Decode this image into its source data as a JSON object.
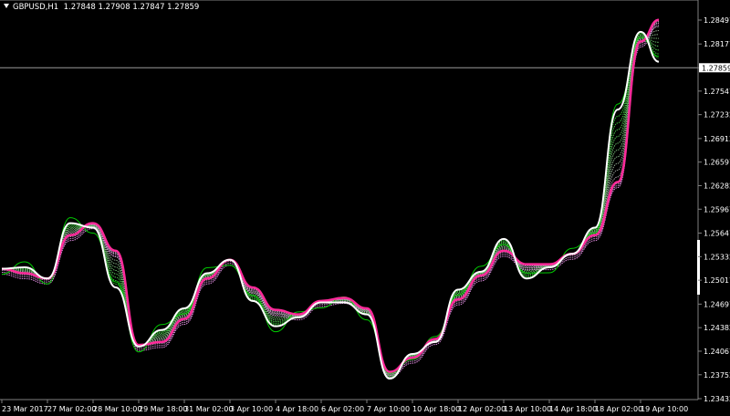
{
  "header": {
    "symbol_timeframe": "GBPUSD,H1",
    "ohlc": "1.27848 1.27908 1.27847 1.27859"
  },
  "colors": {
    "background": "#000000",
    "fast_ma": "#ffffff",
    "slow_ma": "#ff2a9a",
    "ribbon_start": "#22cc22",
    "ribbon_end": "#dd88dd",
    "price": "#00cc00",
    "grid": "#808080"
  },
  "chart_data": {
    "type": "line",
    "title": "",
    "current_price": 1.27859,
    "ylim": [
      1.23432,
      1.28497
    ],
    "y_ticks": [
      "1.28497",
      "1.28177",
      "1.27859",
      "1.27547",
      "1.27232",
      "1.26912",
      "1.26597",
      "1.26282",
      "1.25967",
      "1.25647",
      "1.25332",
      "1.25017",
      "1.24697",
      "1.24382",
      "1.24067",
      "1.23752",
      "1.23432"
    ],
    "x_tick_labels": [
      "23 Mar 2017",
      "27 Mar 02:00",
      "28 Mar 10:00",
      "29 Mar 18:00",
      "31 Mar 02:00",
      "3 Apr 10:00",
      "4 Apr 18:00",
      "6 Apr 02:00",
      "7 Apr 10:00",
      "10 Apr 18:00",
      "12 Apr 02:00",
      "13 Apr 10:00",
      "14 Apr 18:00",
      "18 Apr 02:00",
      "19 Apr 10:00"
    ],
    "x": [
      "23 Mar 18:00",
      "24 Mar 10:00",
      "27 Mar 02:00",
      "27 Mar 18:00",
      "28 Mar 10:00",
      "29 Mar 02:00",
      "29 Mar 18:00",
      "30 Mar 10:00",
      "31 Mar 02:00",
      "31 Mar 18:00",
      "3 Apr 10:00",
      "4 Apr 02:00",
      "4 Apr 18:00",
      "5 Apr 10:00",
      "6 Apr 02:00",
      "6 Apr 18:00",
      "7 Apr 10:00",
      "10 Apr 02:00",
      "10 Apr 18:00",
      "11 Apr 10:00",
      "12 Apr 02:00",
      "12 Apr 18:00",
      "13 Apr 10:00",
      "14 Apr 02:00",
      "14 Apr 18:00",
      "17 Apr 10:00",
      "18 Apr 02:00",
      "18 Apr 18:00",
      "19 Apr 10:00",
      "19 Apr 22:00"
    ],
    "series": [
      {
        "values": [
          1.2517,
          1.2519,
          1.2504,
          1.2578,
          1.2572,
          1.2492,
          1.2413,
          1.2435,
          1.2464,
          1.2511,
          1.2529,
          1.2474,
          1.244,
          1.2452,
          1.2472,
          1.2472,
          1.2456,
          1.237,
          1.2403,
          1.2419,
          1.2489,
          1.2513,
          1.2557,
          1.2504,
          1.2519,
          1.2537,
          1.2572,
          1.273,
          1.2834,
          1.2794
        ]
      },
      {
        "values": [
          1.2517,
          1.2511,
          1.2504,
          1.2562,
          1.2578,
          1.2541,
          1.2415,
          1.2419,
          1.245,
          1.2504,
          1.2529,
          1.2492,
          1.2462,
          1.2456,
          1.2474,
          1.2478,
          1.2464,
          1.2379,
          1.2398,
          1.2423,
          1.2476,
          1.2508,
          1.2541,
          1.2523,
          1.2523,
          1.2537,
          1.2562,
          1.2633,
          1.2821,
          1.285
        ]
      }
    ],
    "grid": false
  }
}
